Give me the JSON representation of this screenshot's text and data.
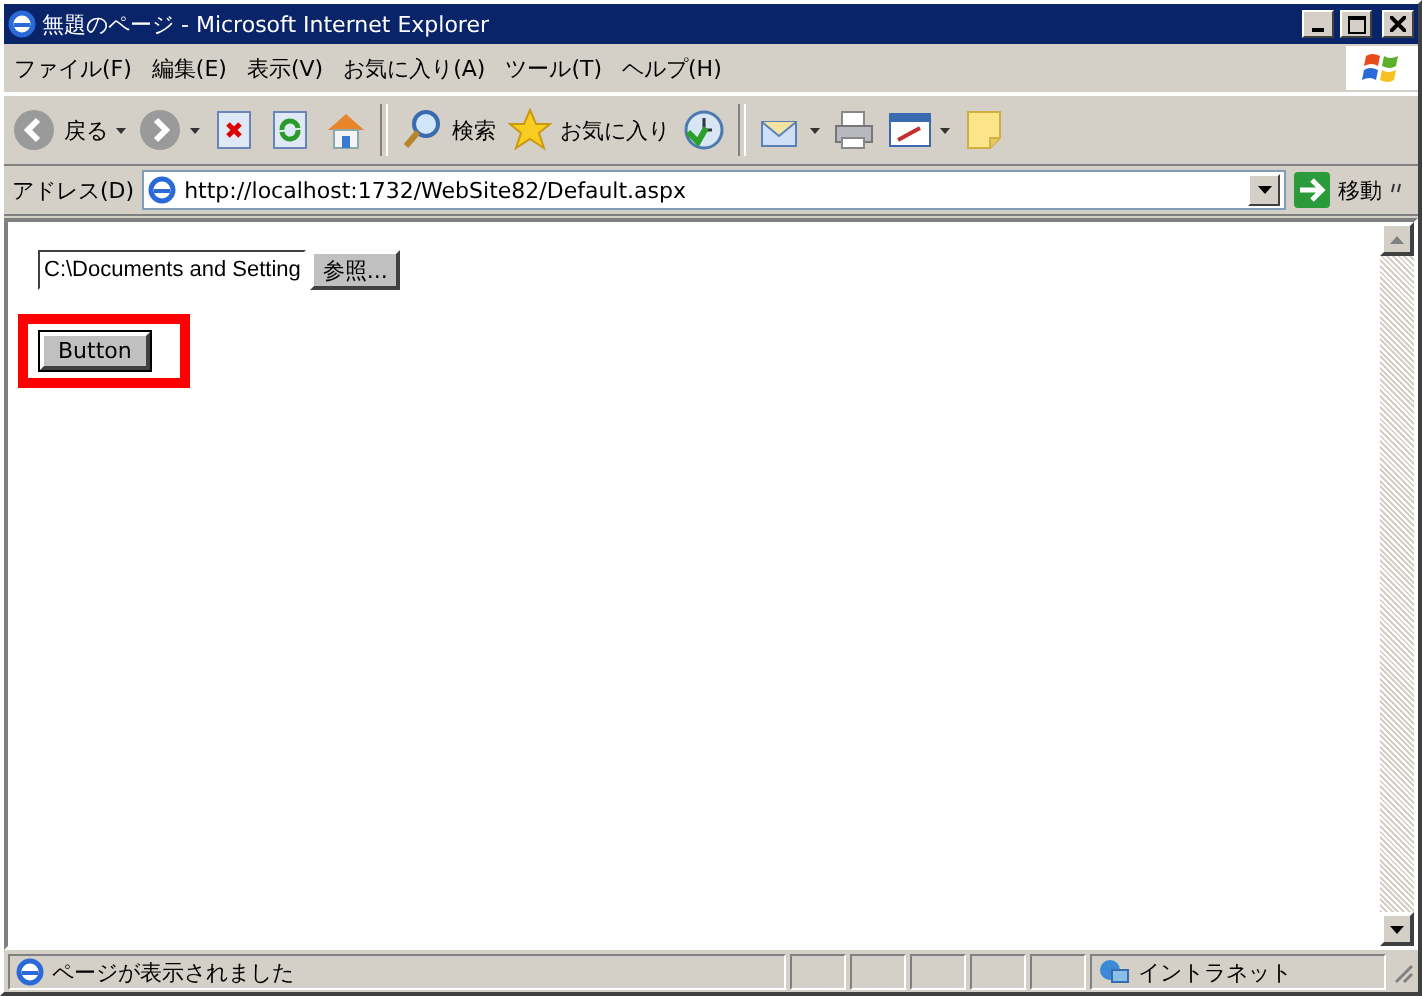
{
  "window": {
    "title": "無題のページ - Microsoft Internet Explorer"
  },
  "menu": [
    "ファイル(F)",
    "編集(E)",
    "表示(V)",
    "お気に入り(A)",
    "ツール(T)",
    "ヘルプ(H)"
  ],
  "toolbar": [
    {
      "kind": "back",
      "label": "戻る"
    },
    {
      "kind": "forward"
    },
    {
      "kind": "stop"
    },
    {
      "kind": "refresh"
    },
    {
      "kind": "home"
    },
    {
      "kind": "separator"
    },
    {
      "kind": "search",
      "label": "検索"
    },
    {
      "kind": "favorites",
      "label": "お気に入り"
    },
    {
      "kind": "history"
    },
    {
      "kind": "separator"
    },
    {
      "kind": "mail"
    },
    {
      "kind": "print"
    },
    {
      "kind": "edit"
    },
    {
      "kind": "note"
    }
  ],
  "address": {
    "label": "アドレス(D)",
    "value": "http://localhost:1732/WebSite82/Default.aspx",
    "go": "移動"
  },
  "page": {
    "file_input": {
      "value": "C:\\Documents and Setting",
      "browse": "参照..."
    },
    "button": {
      "label": "Button",
      "highlighted": true
    }
  },
  "status_bar": {
    "text": "ページが表示されました",
    "zone": "イントラネット"
  }
}
